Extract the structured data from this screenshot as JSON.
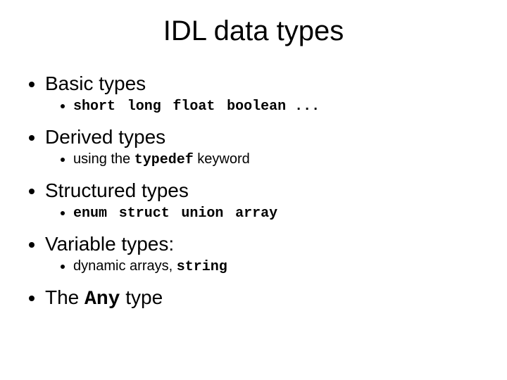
{
  "title": "IDL data types",
  "items": [
    {
      "label": "Basic types",
      "sub": [
        {
          "mono_parts": [
            "short",
            "long",
            "float",
            "boolean ..."
          ]
        }
      ]
    },
    {
      "label": "Derived types",
      "sub": [
        {
          "text_before": "using the ",
          "mono": "typedef",
          "text_after": " keyword"
        }
      ]
    },
    {
      "label": "Structured types",
      "sub": [
        {
          "mono_parts": [
            "enum",
            "struct",
            "union",
            "array"
          ]
        }
      ]
    },
    {
      "label": "Variable types:",
      "sub": [
        {
          "text_before": "dynamic arrays, ",
          "mono": "string",
          "text_after": ""
        }
      ]
    },
    {
      "label_before": "The ",
      "label_mono": "Any",
      "label_after": " type",
      "sub": []
    }
  ]
}
